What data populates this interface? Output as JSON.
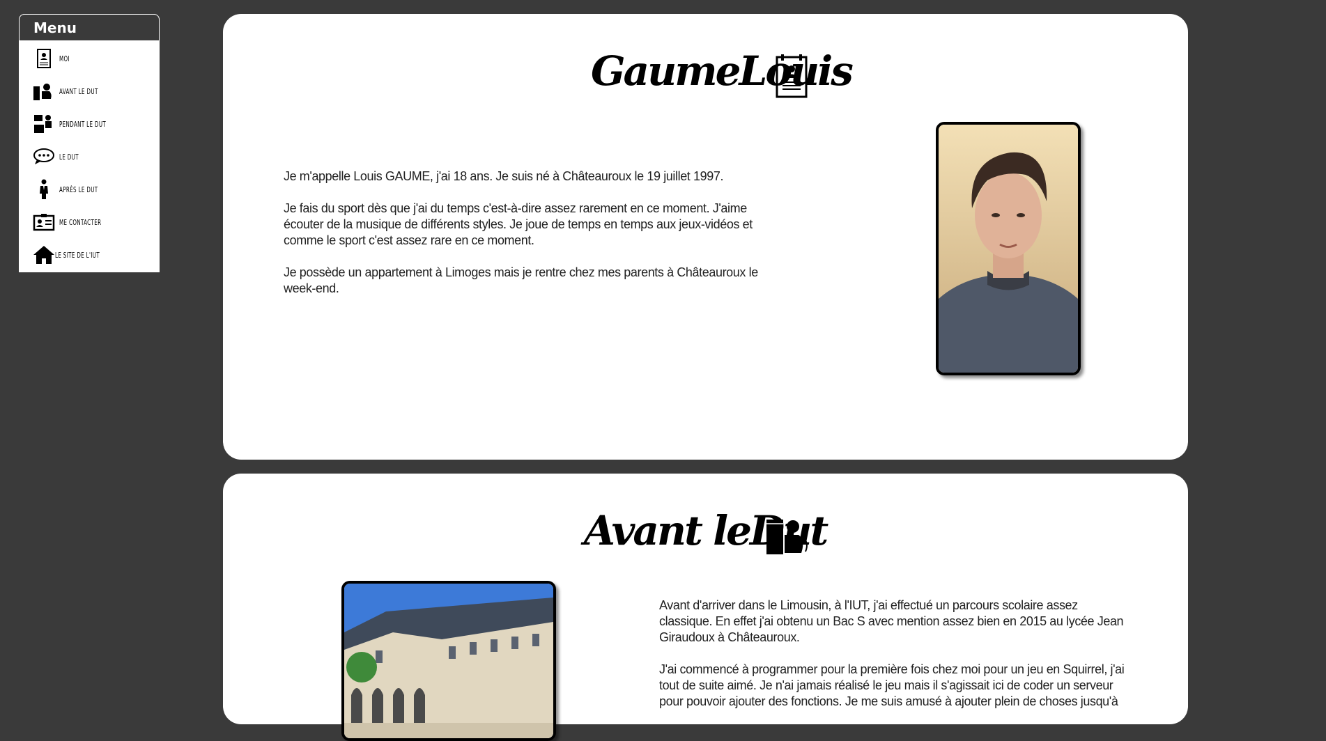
{
  "menu": {
    "title": "Menu",
    "items": [
      {
        "label": "Moi",
        "icon": "resume-icon"
      },
      {
        "label": "Avant le DUT",
        "icon": "student-desk-icon"
      },
      {
        "label": "Pendant le DUT",
        "icon": "classroom-icon"
      },
      {
        "label": "Le DUT",
        "icon": "speech-bubble-icon"
      },
      {
        "label": "Après le DUT",
        "icon": "businessman-icon"
      },
      {
        "label": "Me contacter",
        "icon": "contact-card-icon"
      },
      {
        "label": "Le site de l'IUT",
        "icon": "home-icon"
      }
    ]
  },
  "about": {
    "title": "GaumeLouis",
    "icon": "resume-icon",
    "paragraphs": [
      "Je m'appelle Louis GAUME, j'ai 18 ans. Je suis né à Châteauroux le 19 juillet 1997.",
      "Je fais du sport dès que j'ai du temps c'est-à-dire assez rarement en ce moment. J'aime écouter de la musique de différents styles. Je joue de temps en temps aux jeux-vidéos et comme le sport c'est assez rare en ce moment.",
      "Je possède un appartement à Limoges mais je rentre chez mes parents à Châteauroux le week-end."
    ]
  },
  "before": {
    "title": "Avant leDut",
    "icon": "student-desk-icon",
    "paragraphs": [
      "Avant d'arriver dans le Limousin, à l'IUT, j'ai effectué un parcours scolaire assez classique. En effet j'ai obtenu un Bac S avec mention assez bien en 2015 au lycée Jean Giraudoux à Châteauroux.",
      "J'ai commencé à programmer pour la première fois chez moi pour un jeu en Squirrel, j'ai tout de suite aimé. Je n'ai jamais réalisé le jeu mais il s'agissait ici de coder un serveur pour pouvoir ajouter des fonctions. Je me suis amusé à ajouter plein de choses jusqu'à"
    ]
  },
  "colors": {
    "background": "#3a3a3a",
    "card": "#ffffff",
    "text": "#222222"
  }
}
